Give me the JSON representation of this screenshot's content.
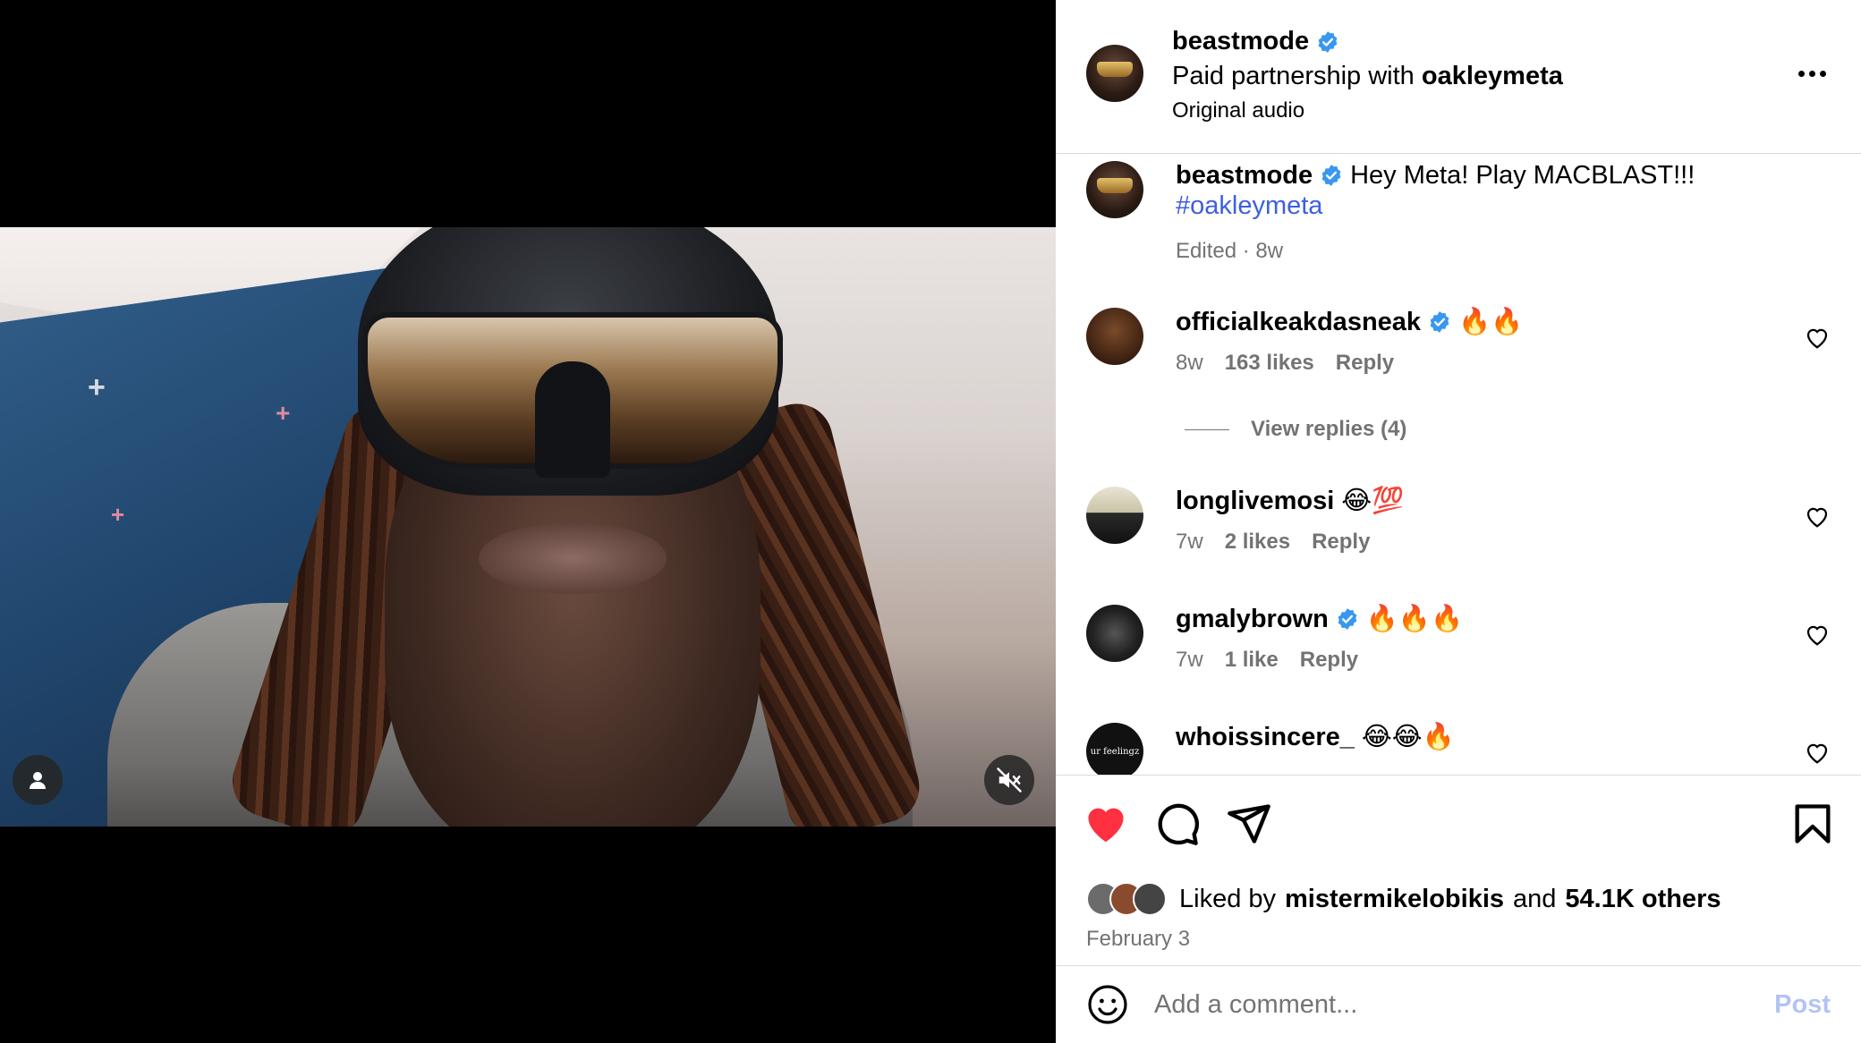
{
  "post": {
    "username": "beastmode",
    "partnership_prefix": "Paid partnership with",
    "partner": "oakleymeta",
    "audio": "Original audio"
  },
  "caption": {
    "username": "beastmode",
    "text": "Hey Meta! Play MACBLAST!!!",
    "hashtag": "#oakleymeta",
    "meta": "Edited · 8w"
  },
  "comments": [
    {
      "username": "officialkeakdasneak",
      "verified": true,
      "text": "🔥🔥",
      "age": "8w",
      "likes": "163 likes",
      "reply": "Reply"
    },
    {
      "username": "longlivemosi",
      "verified": false,
      "text": "😂💯",
      "age": "7w",
      "likes": "2 likes",
      "reply": "Reply"
    },
    {
      "username": "gmalybrown",
      "verified": true,
      "text": "🔥🔥🔥",
      "age": "7w",
      "likes": "1 like",
      "reply": "Reply"
    },
    {
      "username": "whoissincere_",
      "verified": false,
      "text": "😂😂🔥",
      "age": "",
      "likes": "",
      "reply": ""
    }
  ],
  "view_replies": "View replies (4)",
  "avatar_label": "ur feelingz",
  "likes": {
    "prefix": "Liked by",
    "user": "mistermikelobikis",
    "joiner": "and",
    "others": "54.1K others",
    "date": "February 3"
  },
  "comment_box": {
    "placeholder": "Add a comment...",
    "post_label": "Post"
  },
  "colors": {
    "verified": "#3897f0",
    "liked_heart": "#ff3040",
    "link": "#3d5fe0",
    "post_disabled": "#b3c3f5",
    "muted_text": "#737373"
  },
  "icons": [
    "person-icon",
    "mute-icon",
    "verified-icon",
    "more-icon",
    "heart-icon",
    "comment-icon",
    "share-icon",
    "bookmark-icon",
    "emoji-icon"
  ]
}
